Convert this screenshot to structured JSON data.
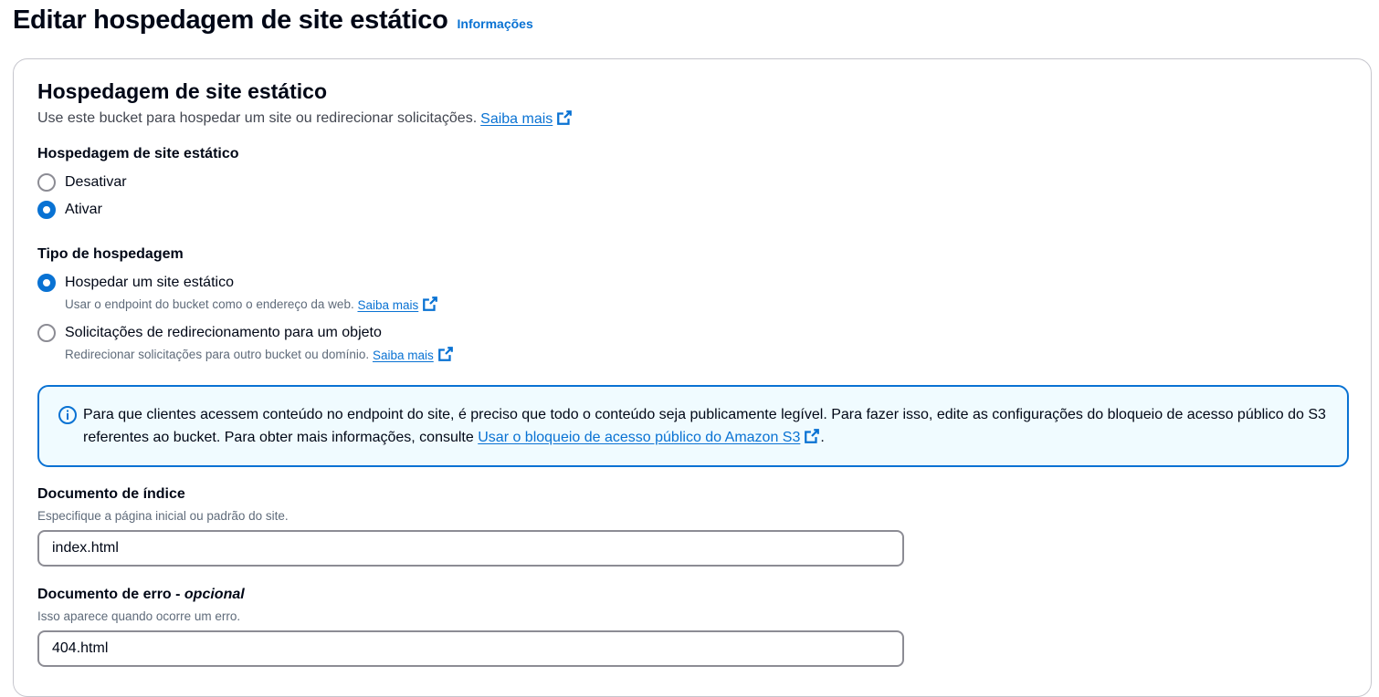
{
  "header": {
    "title": "Editar hospedagem de site estático",
    "info_link": "Informações"
  },
  "section": {
    "title": "Hospedagem de site estático",
    "description": "Use este bucket para hospedar um site ou redirecionar solicitações.",
    "learn_more": "Saiba mais"
  },
  "hosting": {
    "label": "Hospedagem de site estático",
    "options": [
      {
        "label": "Desativar",
        "checked": false
      },
      {
        "label": "Ativar",
        "checked": true
      }
    ]
  },
  "hosting_type": {
    "label": "Tipo de hospedagem",
    "options": [
      {
        "label": "Hospedar um site estático",
        "description": "Usar o endpoint do bucket como o endereço da web.",
        "link": "Saiba mais",
        "checked": true
      },
      {
        "label": "Solicitações de redirecionamento para um objeto",
        "description": "Redirecionar solicitações para outro bucket ou domínio.",
        "link": "Saiba mais",
        "checked": false
      }
    ]
  },
  "alert": {
    "text": "Para que clientes acessem conteúdo no endpoint do site, é preciso que todo o conteúdo seja publicamente legível. Para fazer isso, edite as configurações do bloqueio de acesso público do S3 referentes ao bucket. Para obter mais informações, consulte",
    "link": "Usar o bloqueio de acesso público do Amazon S3",
    "suffix": "."
  },
  "index_document": {
    "label": "Documento de índice",
    "hint": "Especifique a página inicial ou padrão do site.",
    "value": "index.html"
  },
  "error_document": {
    "label": "Documento de erro",
    "separator": " - ",
    "optional": "opcional",
    "hint": "Isso aparece quando ocorre um erro.",
    "value": "404.html"
  },
  "colors": {
    "accent": "#0972d3",
    "alert_bg": "#f0fbff",
    "text": "#000716",
    "muted": "#5f6b7a"
  }
}
